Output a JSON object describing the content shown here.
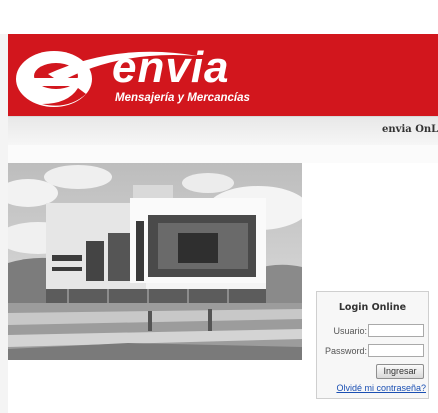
{
  "header": {
    "brand_name": "envia",
    "tagline": "Mensajería y Mercancías",
    "brand_color": "#d2161d",
    "logo_icon": "envia-e-swoosh-logo"
  },
  "subbar": {
    "title": "envia OnLine"
  },
  "hero": {
    "image": "building-photo"
  },
  "login": {
    "title": "Login Online",
    "username_label": "Usuario:",
    "username_value": "",
    "password_label": "Password:",
    "password_value": "",
    "submit_label": "Ingresar",
    "forgot_link": "Olvidé mi contraseña?",
    "link_color": "#1a4fb3"
  }
}
